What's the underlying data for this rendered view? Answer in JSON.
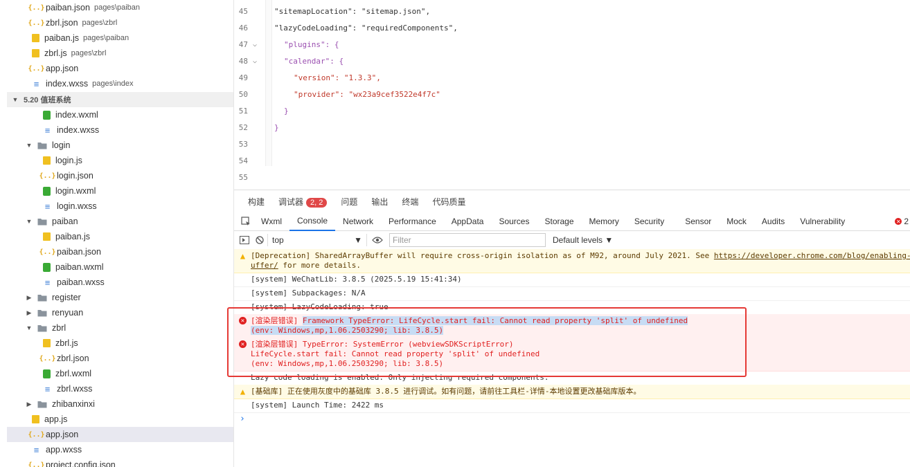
{
  "tree": {
    "top_files": [
      {
        "name": "paiban.json",
        "path": "pages\\paiban",
        "type": "json"
      },
      {
        "name": "zbrl.json",
        "path": "pages\\zbrl",
        "type": "json"
      },
      {
        "name": "paiban.js",
        "path": "pages\\paiban",
        "type": "js"
      },
      {
        "name": "zbrl.js",
        "path": "pages\\zbrl",
        "type": "js"
      },
      {
        "name": "app.json",
        "path": "",
        "type": "json"
      },
      {
        "name": "index.wxss",
        "path": "pages\\index",
        "type": "wxss"
      }
    ],
    "section_title": "5.20 值班系统",
    "items": [
      {
        "name": "index.wxml",
        "type": "wxml"
      },
      {
        "name": "index.wxss",
        "type": "wxss"
      },
      {
        "name": "login",
        "type": "folder-open"
      },
      {
        "name": "login.js",
        "type": "js"
      },
      {
        "name": "login.json",
        "type": "json"
      },
      {
        "name": "login.wxml",
        "type": "wxml"
      },
      {
        "name": "login.wxss",
        "type": "wxss"
      },
      {
        "name": "paiban",
        "type": "folder-open"
      },
      {
        "name": "paiban.js",
        "type": "js"
      },
      {
        "name": "paiban.json",
        "type": "json"
      },
      {
        "name": "paiban.wxml",
        "type": "wxml"
      },
      {
        "name": "paiban.wxss",
        "type": "wxss"
      },
      {
        "name": "register",
        "type": "folder"
      },
      {
        "name": "renyuan",
        "type": "folder"
      },
      {
        "name": "zbrl",
        "type": "folder-open"
      },
      {
        "name": "zbrl.js",
        "type": "js"
      },
      {
        "name": "zbrl.json",
        "type": "json"
      },
      {
        "name": "zbrl.wxml",
        "type": "wxml"
      },
      {
        "name": "zbrl.wxss",
        "type": "wxss"
      },
      {
        "name": "zhibanxinxi",
        "type": "folder"
      },
      {
        "name": "app.js",
        "type": "js"
      },
      {
        "name": "app.json",
        "type": "json"
      },
      {
        "name": "app.wxss",
        "type": "wxss"
      },
      {
        "name": "project.config.json",
        "type": "json"
      }
    ]
  },
  "editor": {
    "lines": [
      {
        "n": "45",
        "text": "\"sitemapLocation\": \"sitemap.json\","
      },
      {
        "n": "46",
        "text": "\"lazyCodeLoading\": \"requiredComponents\","
      },
      {
        "n": "47",
        "text": "\"plugins\": {"
      },
      {
        "n": "48",
        "text": "\"calendar\": {"
      },
      {
        "n": "49",
        "text": "\"version\": \"1.3.3\","
      },
      {
        "n": "50",
        "text": "\"provider\": \"wx23a9cef3522e4f7c\""
      },
      {
        "n": "51",
        "text": "}"
      },
      {
        "n": "52",
        "text": "}"
      },
      {
        "n": "53",
        "text": ""
      },
      {
        "n": "54",
        "text": ""
      },
      {
        "n": "55",
        "text": ""
      }
    ]
  },
  "panel": {
    "tabs": [
      "构建",
      "调试器",
      "问题",
      "输出",
      "终端",
      "代码质量"
    ],
    "debugger_badge": "2, 2",
    "devtools_tabs": [
      "Wxml",
      "Console",
      "Network",
      "Performance",
      "AppData",
      "Sources",
      "Storage",
      "Memory",
      "Security",
      "Sensor",
      "Mock",
      "Audits",
      "Vulnerability"
    ],
    "error_count": "2",
    "context": "top",
    "filter_placeholder": "Filter",
    "levels": "Default levels ▼"
  },
  "console": {
    "messages": [
      {
        "level": "warn",
        "line1a": "[Deprecation] SharedArrayBuffer will require cross-origin isolation as of M92, around July 2021. See ",
        "link": "https://developer.chrome.com/blog/enabling-s",
        "line2a": "uffer/",
        "line2b": " for more details."
      },
      {
        "level": "info",
        "text": "[system] WeChatLib: 3.8.5 (2025.5.19 15:41:34)"
      },
      {
        "level": "info",
        "text": "[system] Subpackages: N/A"
      },
      {
        "level": "info",
        "text": "[system] LazyCodeLoading: true"
      },
      {
        "level": "error",
        "prefix": "[渲染层错误] ",
        "line1": "Framework TypeError: LifeCycle.start fail: Cannot read property 'split' of undefined",
        "line2": "(env: Windows,mp,1.06.2503290; lib: 3.8.5)"
      },
      {
        "level": "error",
        "line1": "[渲染层错误] TypeError: SystemError (webviewSDKScriptError)",
        "line2": "LifeCycle.start fail: Cannot read property 'split' of undefined",
        "line3": "(env: Windows,mp,1.06.2503290; lib: 3.8.5)"
      },
      {
        "level": "info",
        "text": "Lazy code loading is enabled. Only injecting required components."
      },
      {
        "level": "warn",
        "text": "[基础库] 正在使用灰度中的基础库 3.8.5 进行调试。如有问题，请前往工具栏-详情-本地设置更改基础库版本。"
      },
      {
        "level": "info",
        "text": "[system] Launch Time: 2422 ms"
      }
    ],
    "prompt": "›"
  }
}
